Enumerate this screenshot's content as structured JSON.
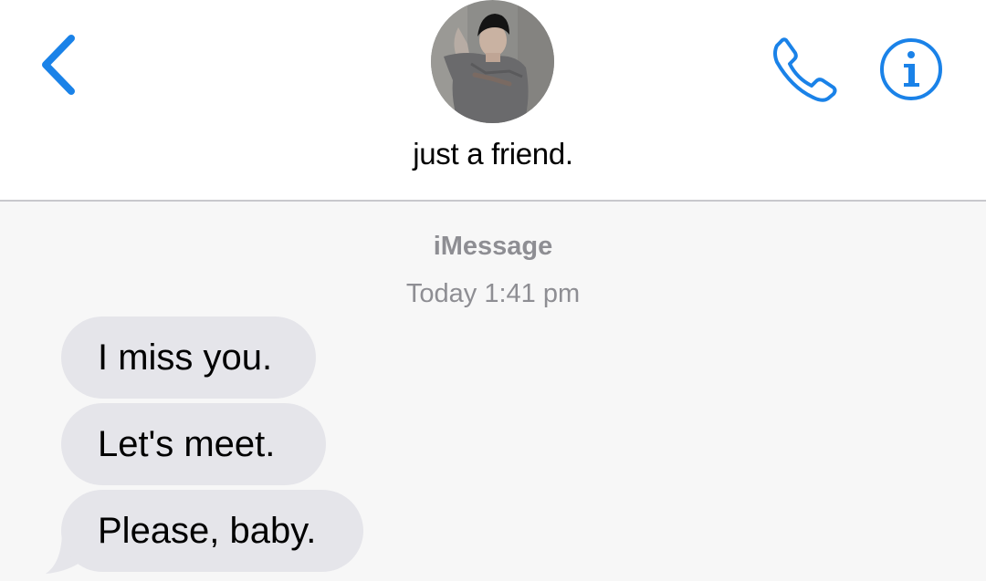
{
  "header": {
    "contact_name": "just a friend.",
    "back_icon": "chevron-left-icon",
    "call_icon": "phone-icon",
    "info_icon": "info-icon"
  },
  "thread": {
    "service": "iMessage",
    "timestamp": "Today 1:41 pm",
    "messages": [
      {
        "text": "I miss you.",
        "direction": "incoming"
      },
      {
        "text": "Let's meet.",
        "direction": "incoming"
      },
      {
        "text": "Please, baby.",
        "direction": "incoming"
      }
    ]
  },
  "colors": {
    "accent": "#1a82e8",
    "bubble_incoming": "#e5e5ea",
    "thread_background": "#f7f7f7",
    "meta_text": "#8e8e93"
  }
}
